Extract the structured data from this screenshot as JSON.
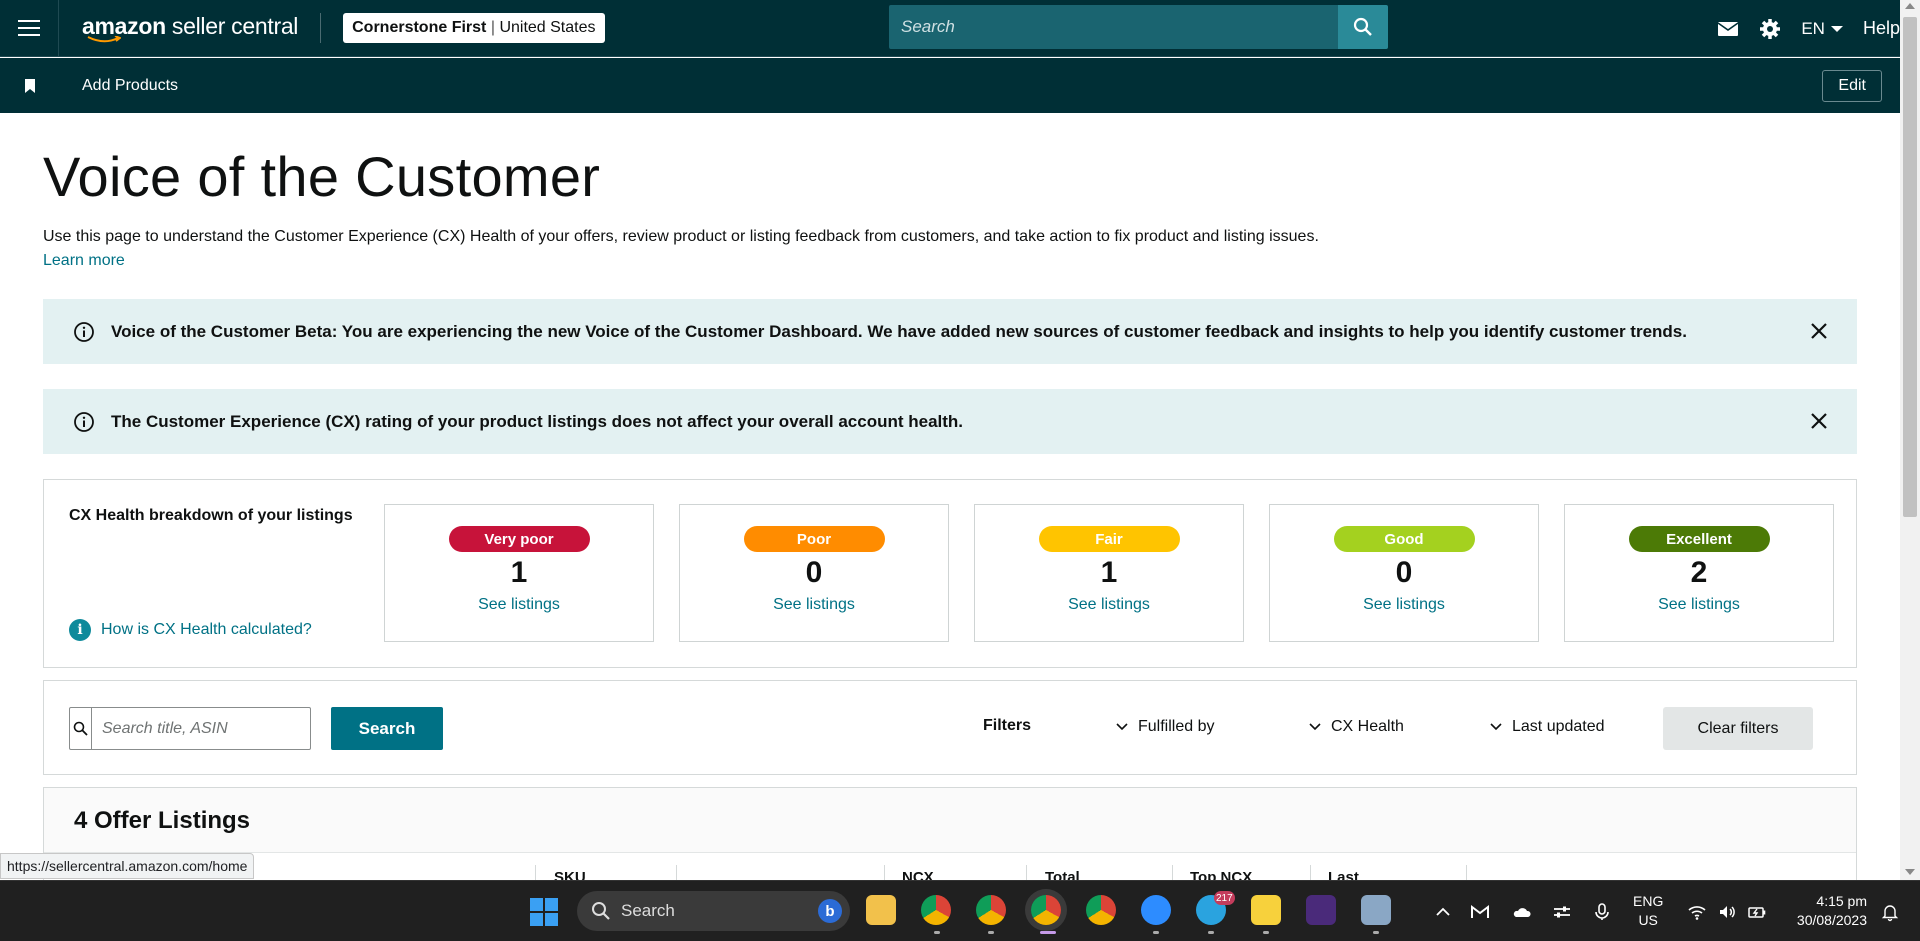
{
  "topnav": {
    "logo_prefix": "amazon",
    "logo_suffix": " seller central",
    "account_name": "Cornerstone First",
    "account_region": "United States",
    "search_placeholder": "Search",
    "language": "EN",
    "help": "Help"
  },
  "subnav": {
    "add_products": "Add Products",
    "edit": "Edit"
  },
  "page": {
    "title": "Voice of the Customer",
    "description": "Use this page to understand the Customer Experience (CX) Health of your offers, review product or listing feedback from customers, and take action to fix product and listing issues.",
    "learn_more": "Learn more"
  },
  "banners": [
    {
      "text": "Voice of the Customer Beta: You are experiencing the new Voice of the Customer Dashboard. We have added new sources of customer feedback and insights to help you identify customer trends."
    },
    {
      "text": "The Customer Experience (CX) rating of your product listings does not affect your overall account health."
    }
  ],
  "cx_health": {
    "title": "CX Health breakdown of your listings",
    "how_link": "How is CX Health calculated?",
    "cards": [
      {
        "label": "Very poor",
        "count": "1",
        "link": "See listings",
        "color": "#c7133a",
        "text_color": "#ffffff"
      },
      {
        "label": "Poor",
        "count": "0",
        "link": "See listings",
        "color": "#ff8c00",
        "text_color": "#ffffff"
      },
      {
        "label": "Fair",
        "count": "1",
        "link": "See listings",
        "color": "#ffc400",
        "text_color": "#ffffff"
      },
      {
        "label": "Good",
        "count": "0",
        "link": "See listings",
        "color": "#a4d11f",
        "text_color": "#ffffff"
      },
      {
        "label": "Excellent",
        "count": "2",
        "link": "See listings",
        "color": "#4c7a06",
        "text_color": "#ffffff"
      }
    ]
  },
  "filters": {
    "search_placeholder": "Search title, ASIN",
    "search_button": "Search",
    "label": "Filters",
    "fulfilled_by": "Fulfilled by",
    "cx_health": "CX Health",
    "last_updated": "Last updated",
    "clear": "Clear filters"
  },
  "listings": {
    "title": "4 Offer Listings",
    "columns": [
      "SKU",
      "NCX",
      "Total",
      "Top NCX",
      "Last"
    ]
  },
  "status_url": "https://sellercentral.amazon.com/home",
  "taskbar": {
    "search": "Search",
    "lang_line1": "ENG",
    "lang_line2": "US",
    "time": "4:15 pm",
    "date": "30/08/2023",
    "telegram_badge": "217"
  }
}
